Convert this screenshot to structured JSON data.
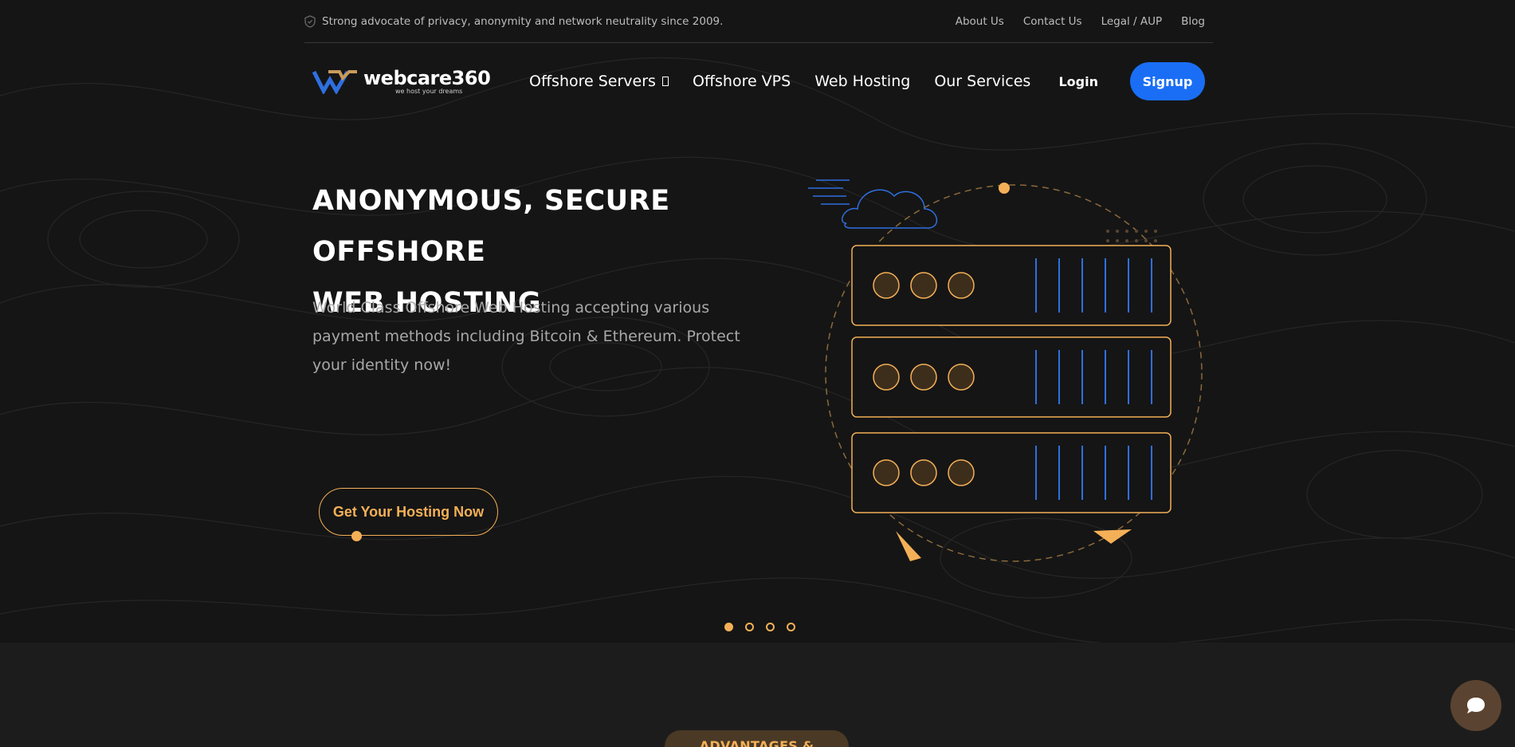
{
  "topbar": {
    "tagline": "Strong advocate of privacy, anonymity and network neutrality since 2009.",
    "links": [
      "About Us",
      "Contact Us",
      "Legal / AUP",
      "Blog"
    ]
  },
  "nav": {
    "logo_name": "webcare360",
    "logo_sub": "we host your dreams",
    "menu": [
      "Offshore Servers",
      "Offshore VPS",
      "Web Hosting",
      "Our Services"
    ],
    "login": "Login",
    "signup": "Signup"
  },
  "hero": {
    "title_line1": "ANONYMOUS, SECURE OFFSHORE",
    "title_line2": "WEB HOSTING",
    "description": "World Class Offshore Web Hosting accepting various payment methods including Bitcoin & Ethereum. Protect your identity now!",
    "cta": "Get Your Hosting Now"
  },
  "slider": {
    "count": 4,
    "active": 0
  },
  "section_badge": "ADVANTAGES & BENEFITS",
  "colors": {
    "accent": "#f4b057",
    "primary_blue": "#1a6ef5",
    "background": "#151515"
  },
  "icons": {
    "tagline": "shield-icon",
    "chat": "chat-bubble-icon",
    "server_illustration": "server-rack-cloud-icon"
  }
}
